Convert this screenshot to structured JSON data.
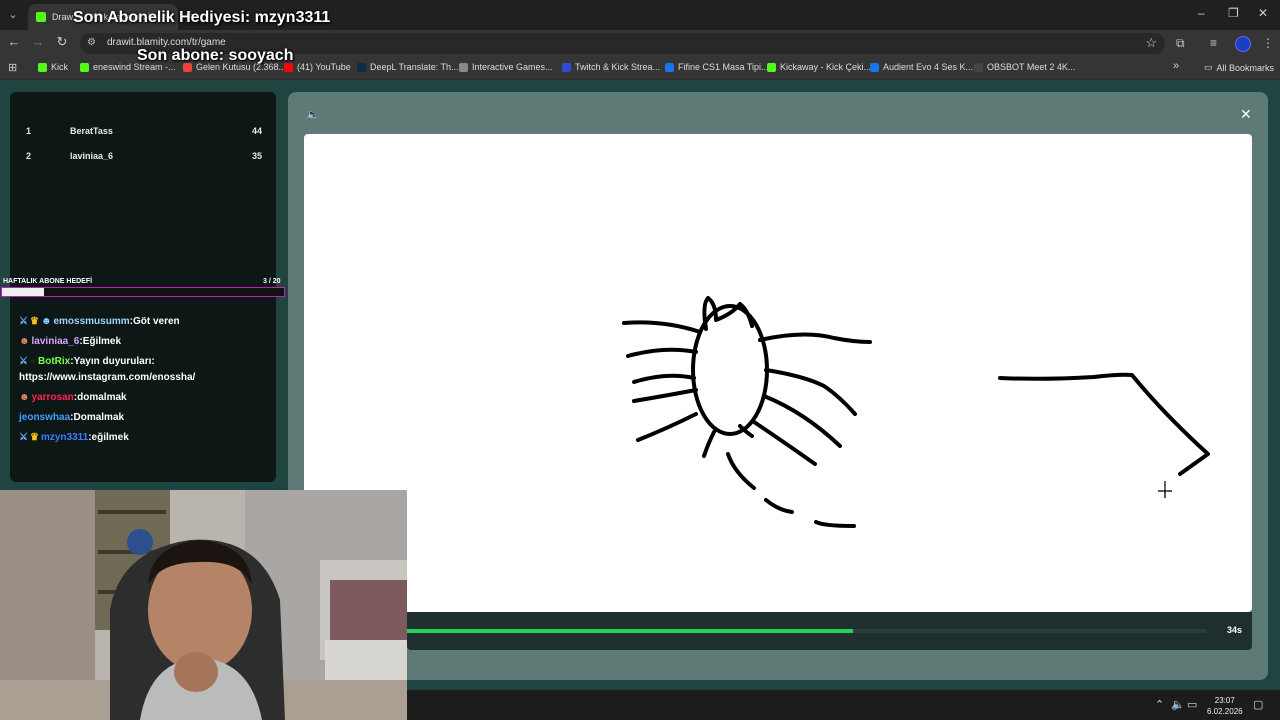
{
  "browser": {
    "tab_title": "Draw It! - Kick Yayınları İçin...",
    "url": "drawit.blamity.com/tr/game",
    "bookmarks": [
      {
        "label": "Kick",
        "color": "#53fc18"
      },
      {
        "label": "eneswind Stream -...",
        "color": "#53fc18"
      },
      {
        "label": "Gelen Kutusu (2.368...",
        "color": "#ea4335"
      },
      {
        "label": "(41) YouTube",
        "color": "#ff0000"
      },
      {
        "label": "DeepL Translate: Th...",
        "color": "#0f2b46"
      },
      {
        "label": "Interactive Games...",
        "color": "#888888"
      },
      {
        "label": "Twitch & Kick Strea...",
        "color": "#2b4bd8"
      },
      {
        "label": "Fifine CS1 Masa Tipi...",
        "color": "#1a73e8"
      },
      {
        "label": "Kickaway - Kick Çeki...",
        "color": "#53fc18"
      },
      {
        "label": "Audient Evo 4 Ses K...",
        "color": "#1a73e8"
      },
      {
        "label": "OBSBOT Meet 2 4K...",
        "color": "#444444"
      }
    ],
    "all_bookmarks": "All Bookmarks"
  },
  "overlay": {
    "last_gift": "Son Abonelik Hediyesi: mzyn3311",
    "last_sub": "Son abone: sooyach"
  },
  "leaderboard": [
    {
      "rank": "1",
      "name": "BeratTass",
      "score": "44"
    },
    {
      "rank": "2",
      "name": "laviniaa_6",
      "score": "35"
    }
  ],
  "sub_goal": {
    "label": "HAFTALIK ABONE HEDEFİ",
    "count": "3  /  20",
    "progress": 0.15
  },
  "chat": [
    {
      "user": "emossmusumm",
      "message": "Göt veren"
    },
    {
      "user": "laviniaa_6",
      "message": "Eğilmek"
    },
    {
      "user": "BotRix",
      "message": "Yayın duyuruları:"
    },
    {
      "user": "",
      "message": "https://www.instagram.com/enossha/"
    },
    {
      "user": "yarrosan",
      "message": "domalmak"
    },
    {
      "user": "jeonswhaa",
      "message": "Domalmak"
    },
    {
      "user": "mzyn3311",
      "message": "eğilmek"
    }
  ],
  "game": {
    "timer": "34s",
    "timer_progress": 0.558
  },
  "taskbar": {
    "time": "23:07",
    "date": "6.02.2026"
  }
}
